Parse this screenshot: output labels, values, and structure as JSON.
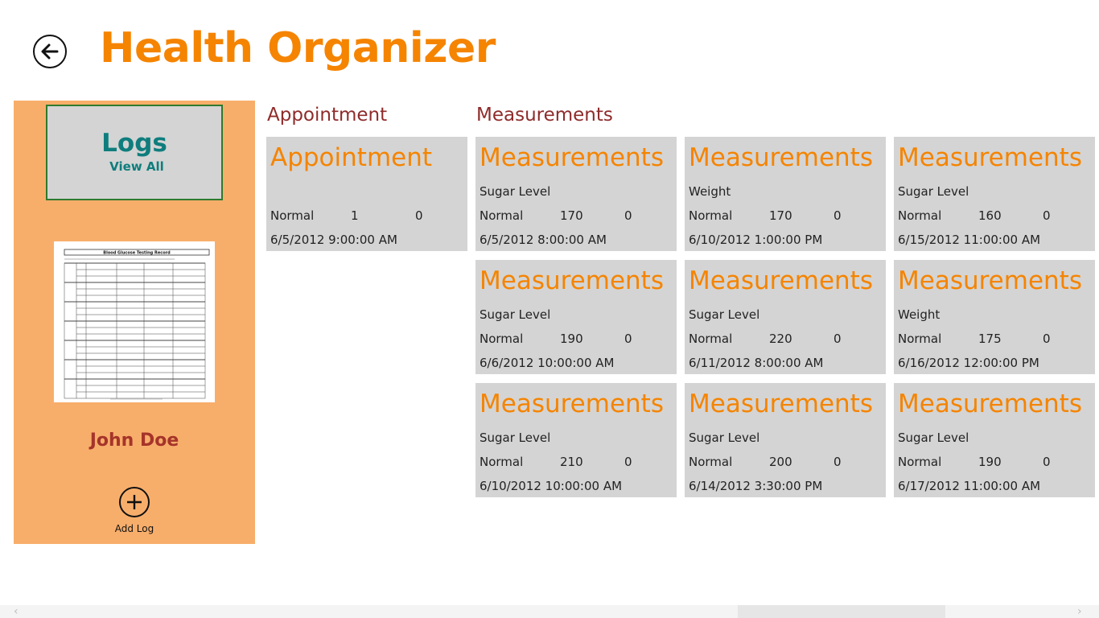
{
  "header": {
    "title": "Health Organizer"
  },
  "sidebar": {
    "logs_title": "Logs",
    "logs_subtitle": "View All",
    "thumbnail_title": "Blood Glucose Testing Record",
    "user_name": "John Doe",
    "add_label": "Add Log"
  },
  "groups": {
    "appointment": {
      "header": "Appointment"
    },
    "measurements": {
      "header": "Measurements"
    }
  },
  "appointments": [
    {
      "title": "Appointment",
      "subtitle": "",
      "status": "Normal",
      "value": "1",
      "extra": "0",
      "date": "6/5/2012 9:00:00 AM"
    }
  ],
  "measurements": [
    {
      "title": "Measurements",
      "subtitle": "Sugar Level",
      "status": "Normal",
      "value": "170",
      "extra": "0",
      "date": "6/5/2012 8:00:00 AM"
    },
    {
      "title": "Measurements",
      "subtitle": "Sugar Level",
      "status": "Normal",
      "value": "190",
      "extra": "0",
      "date": "6/6/2012 10:00:00 AM"
    },
    {
      "title": "Measurements",
      "subtitle": "Sugar Level",
      "status": "Normal",
      "value": "210",
      "extra": "0",
      "date": "6/10/2012 10:00:00 AM"
    },
    {
      "title": "Measurements",
      "subtitle": "Weight",
      "status": "Normal",
      "value": "170",
      "extra": "0",
      "date": "6/10/2012 1:00:00 PM"
    },
    {
      "title": "Measurements",
      "subtitle": "Sugar Level",
      "status": "Normal",
      "value": "220",
      "extra": "0",
      "date": "6/11/2012 8:00:00 AM"
    },
    {
      "title": "Measurements",
      "subtitle": "Sugar Level",
      "status": "Normal",
      "value": "200",
      "extra": "0",
      "date": "6/14/2012 3:30:00 PM"
    },
    {
      "title": "Measurements",
      "subtitle": "Sugar Level",
      "status": "Normal",
      "value": "160",
      "extra": "0",
      "date": "6/15/2012 11:00:00 AM"
    },
    {
      "title": "Measurements",
      "subtitle": "Weight",
      "status": "Normal",
      "value": "175",
      "extra": "0",
      "date": "6/16/2012 12:00:00 PM"
    },
    {
      "title": "Measurements",
      "subtitle": "Sugar Level",
      "status": "Normal",
      "value": "190",
      "extra": "0",
      "date": "6/17/2012 11:00:00 AM"
    }
  ],
  "colors": {
    "accent": "#f58400",
    "panel": "#f8ae6b",
    "tile": "#d4d4d4",
    "group_header": "#8f2b2b",
    "user_name": "#a5342a",
    "logs_text": "#0f7d7d",
    "logs_border": "#2d7a2d"
  },
  "icons": {
    "back": "back-arrow-icon",
    "add": "plus-icon",
    "scroll_left": "chevron-left-icon",
    "scroll_right": "chevron-right-icon"
  }
}
